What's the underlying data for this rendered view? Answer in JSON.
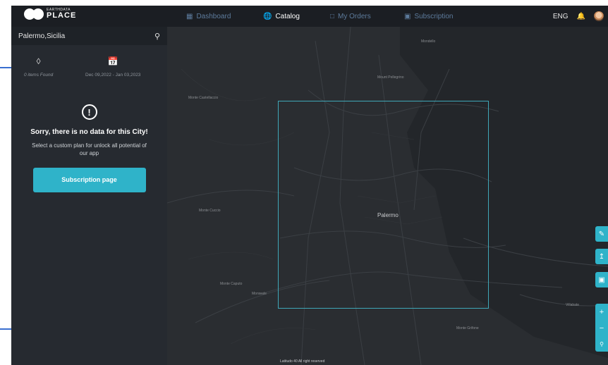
{
  "header": {
    "logo_small": "EARTHDATA",
    "logo_big": "PLACE",
    "nav": [
      {
        "label": "Dashboard",
        "icon": "dashboard-icon",
        "active": false
      },
      {
        "label": "Catalog",
        "icon": "globe-icon",
        "active": true
      },
      {
        "label": "My Orders",
        "icon": "folder-icon",
        "active": false
      },
      {
        "label": "Subscription",
        "icon": "subscription-icon",
        "active": false
      }
    ],
    "language": "ENG"
  },
  "sidebar": {
    "search_value": "Palermo,Sicilia",
    "items_found": "0 items Found",
    "date_range": "Dec 09,2022 - Jan 03,2023",
    "message_title": "Sorry, there is no data for this City!",
    "message_sub": "Select a custom plan for unlock all potential of our app",
    "button_label": "Subscription page"
  },
  "map": {
    "city_label": "Palermo",
    "labels": [
      "Monte Castellaccio",
      "Monte Cuccio",
      "Monte Caputo",
      "Monreale",
      "Monte Grifone",
      "Villabate",
      "Mondello",
      "Mount Pellegrino"
    ],
    "footer": "Latitudo 40 All right reserved"
  },
  "colors": {
    "accent": "#2fb3c9",
    "background": "#222529",
    "nav_inactive": "#5d7b9c"
  }
}
